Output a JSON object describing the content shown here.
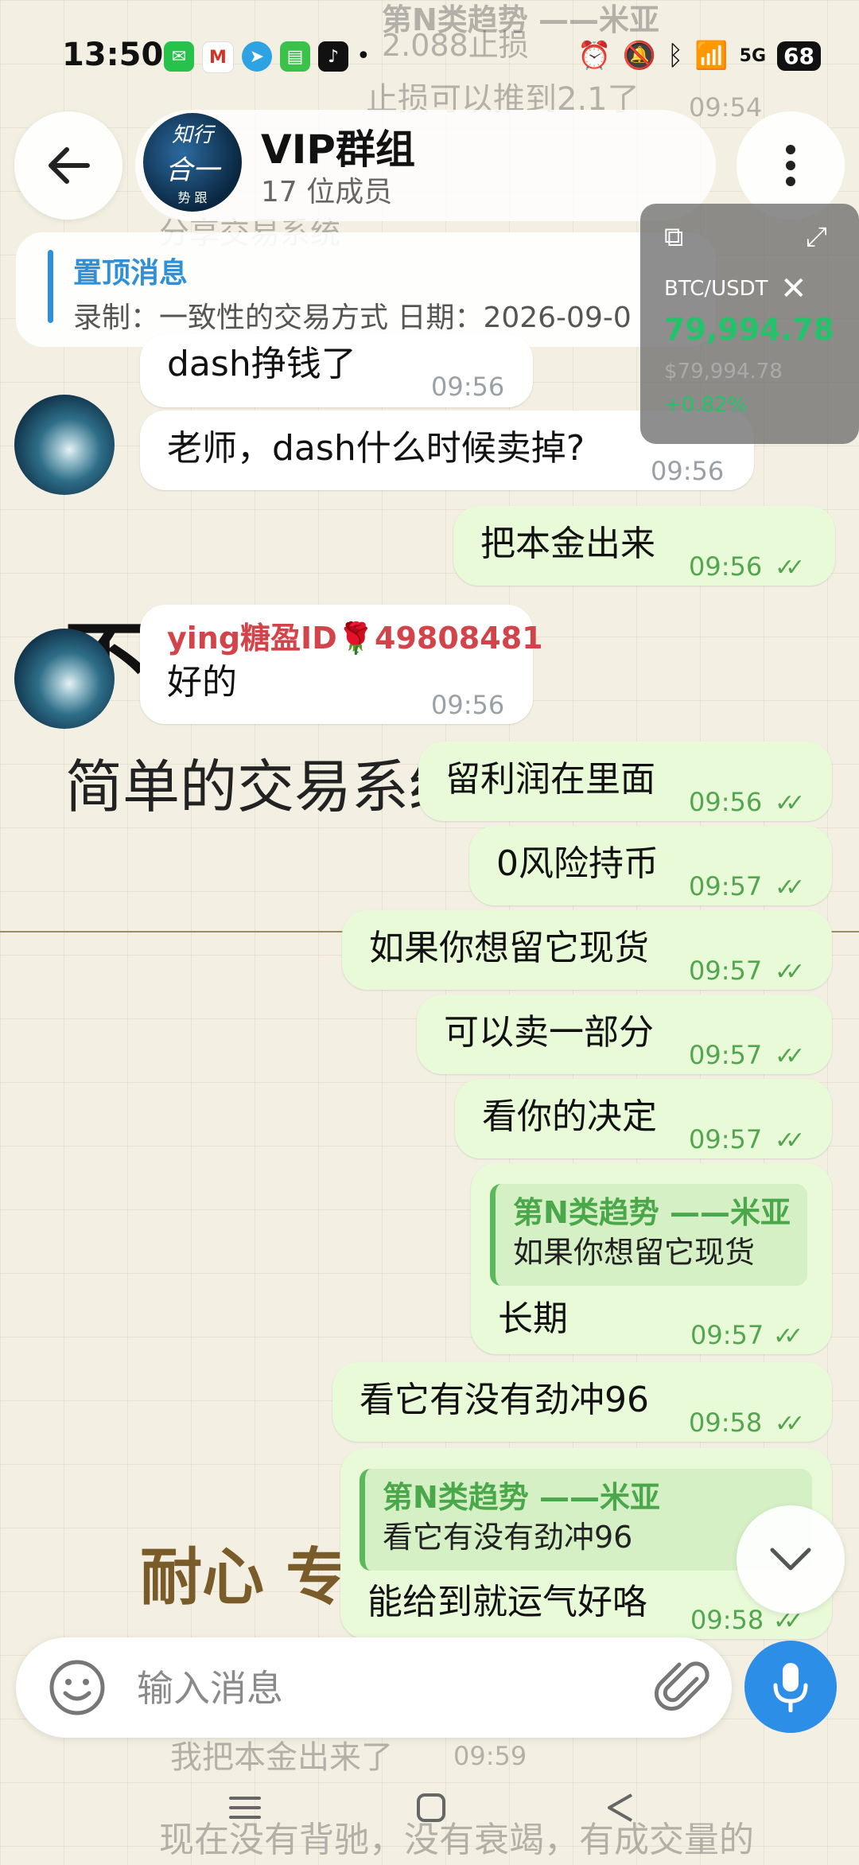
{
  "status": {
    "time": "13:50",
    "signal": "5G",
    "battery": "68"
  },
  "header": {
    "avatar_line1": "知行",
    "avatar_line2": "合一",
    "avatar_line3": "势 跟",
    "title": "VIP群组",
    "subtitle": "17 位成员"
  },
  "pinned": {
    "title": "置顶消息",
    "text": "录制：一致性的交易方式 日期：2026-09-0"
  },
  "widget": {
    "pair": "BTC/USDT",
    "price": "79,994.78",
    "price_usd": "$79,994.78",
    "change": "+0.82%"
  },
  "background": {
    "big_text": "不        频繁交易",
    "mid_text": "简单的交易系统",
    "gold_text": "耐心 专",
    "ghost_top1": "第N类趋势  ——米亚",
    "ghost_top2": "2.088止损",
    "ghost_top3": "止损可以推到2.1了",
    "ghost_top4": "09:54",
    "ghost_sys": "分享交易系统",
    "ghost_bottom1": "我把本金出来了",
    "ghost_bottom1_time": "09:59",
    "ghost_bottom2": "现在没有背驰，没有衰竭，有成交量的"
  },
  "messages": [
    {
      "text": "dash挣钱了",
      "time": "09:56"
    },
    {
      "text": "老师，dash什么时候卖掉?",
      "time": "09:56"
    },
    {
      "text": "把本金出来",
      "time": "09:56"
    },
    {
      "sender": "ying糖盈ID🌹49808481",
      "text": "好的",
      "time": "09:56"
    },
    {
      "text": "留利润在里面",
      "time": "09:56"
    },
    {
      "text": "0风险持币",
      "time": "09:57"
    },
    {
      "text": "如果你想留它现货",
      "time": "09:57"
    },
    {
      "text": "可以卖一部分",
      "time": "09:57"
    },
    {
      "text": "看你的决定",
      "time": "09:57"
    },
    {
      "reply_title": "第N类趋势 ——米亚",
      "reply_text": "如果你想留它现货",
      "text": "长期",
      "time": "09:57"
    },
    {
      "text": "看它有没有劲冲96",
      "time": "09:58"
    },
    {
      "reply_title": "第N类趋势 ——米亚",
      "reply_text": "看它有没有劲冲96",
      "text": "能给到就运气好咯",
      "time": "09:58"
    }
  ],
  "input": {
    "placeholder": "输入消息"
  },
  "colors": {
    "accent": "#2f8fd8",
    "outgoing_bubble": "#e9fad9",
    "sender_name": "#d2444a",
    "check": "#53a64f"
  }
}
